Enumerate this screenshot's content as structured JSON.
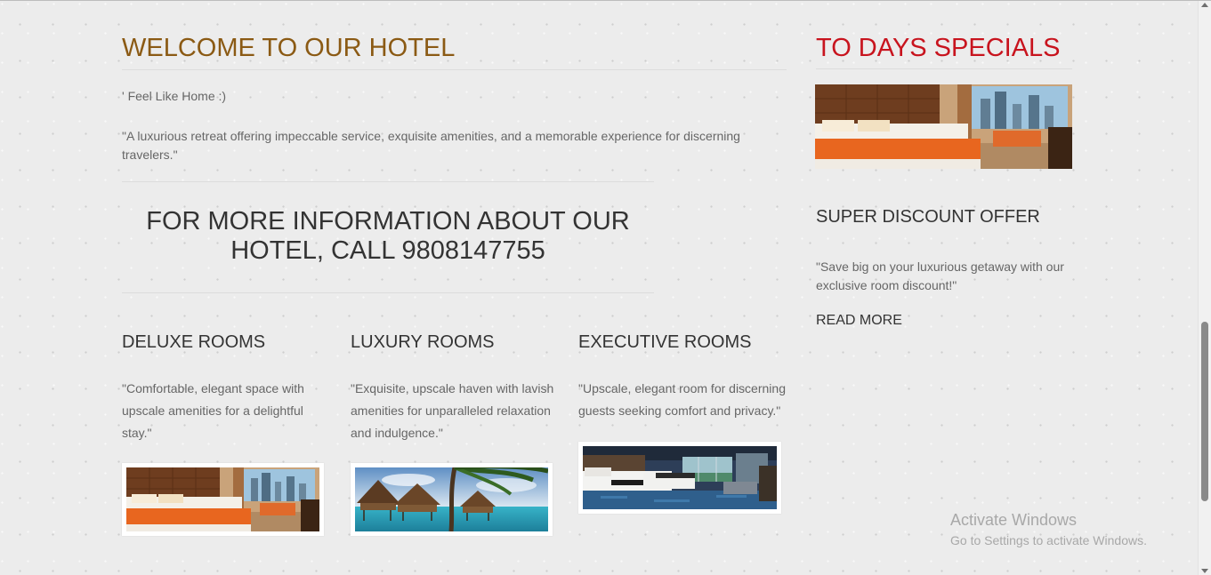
{
  "colors": {
    "welcome_heading": "#8b5a14",
    "specials_heading": "#c8141e",
    "text": "#666666",
    "heading": "#333333"
  },
  "welcome": {
    "title": "WELCOME TO OUR HOTEL",
    "tagline": "' Feel Like Home :)",
    "quote": "\"A luxurious retreat offering impeccable service, exquisite amenities, and a memorable experience for discerning travelers.\""
  },
  "info": {
    "call_text": "FOR MORE INFORMATION ABOUT OUR HOTEL, CALL 9808147755"
  },
  "rooms": [
    {
      "title": "DELUXE ROOMS",
      "description": "\"Comfortable, elegant space with upscale amenities for a delightful stay.\"",
      "image_icon": "hotel-room-photo"
    },
    {
      "title": "LUXURY ROOMS",
      "description": "\"Exquisite, upscale haven with lavish amenities for unparalleled relaxation and indulgence.\"",
      "image_icon": "overwater-bungalow-photo"
    },
    {
      "title": "EXECUTIVE ROOMS",
      "description": "\"Upscale, elegant room for discerning guests seeking comfort and privacy.\"",
      "image_icon": "executive-room-photo"
    }
  ],
  "specials": {
    "title": "TO DAYS SPECIALS",
    "offer_title": "SUPER DISCOUNT OFFER",
    "offer_text": "\"Save big on your luxurious getaway with our exclusive room discount!\"",
    "read_more": "READ MORE"
  },
  "watermark": {
    "title": "Activate Windows",
    "subtitle": "Go to Settings to activate Windows."
  }
}
